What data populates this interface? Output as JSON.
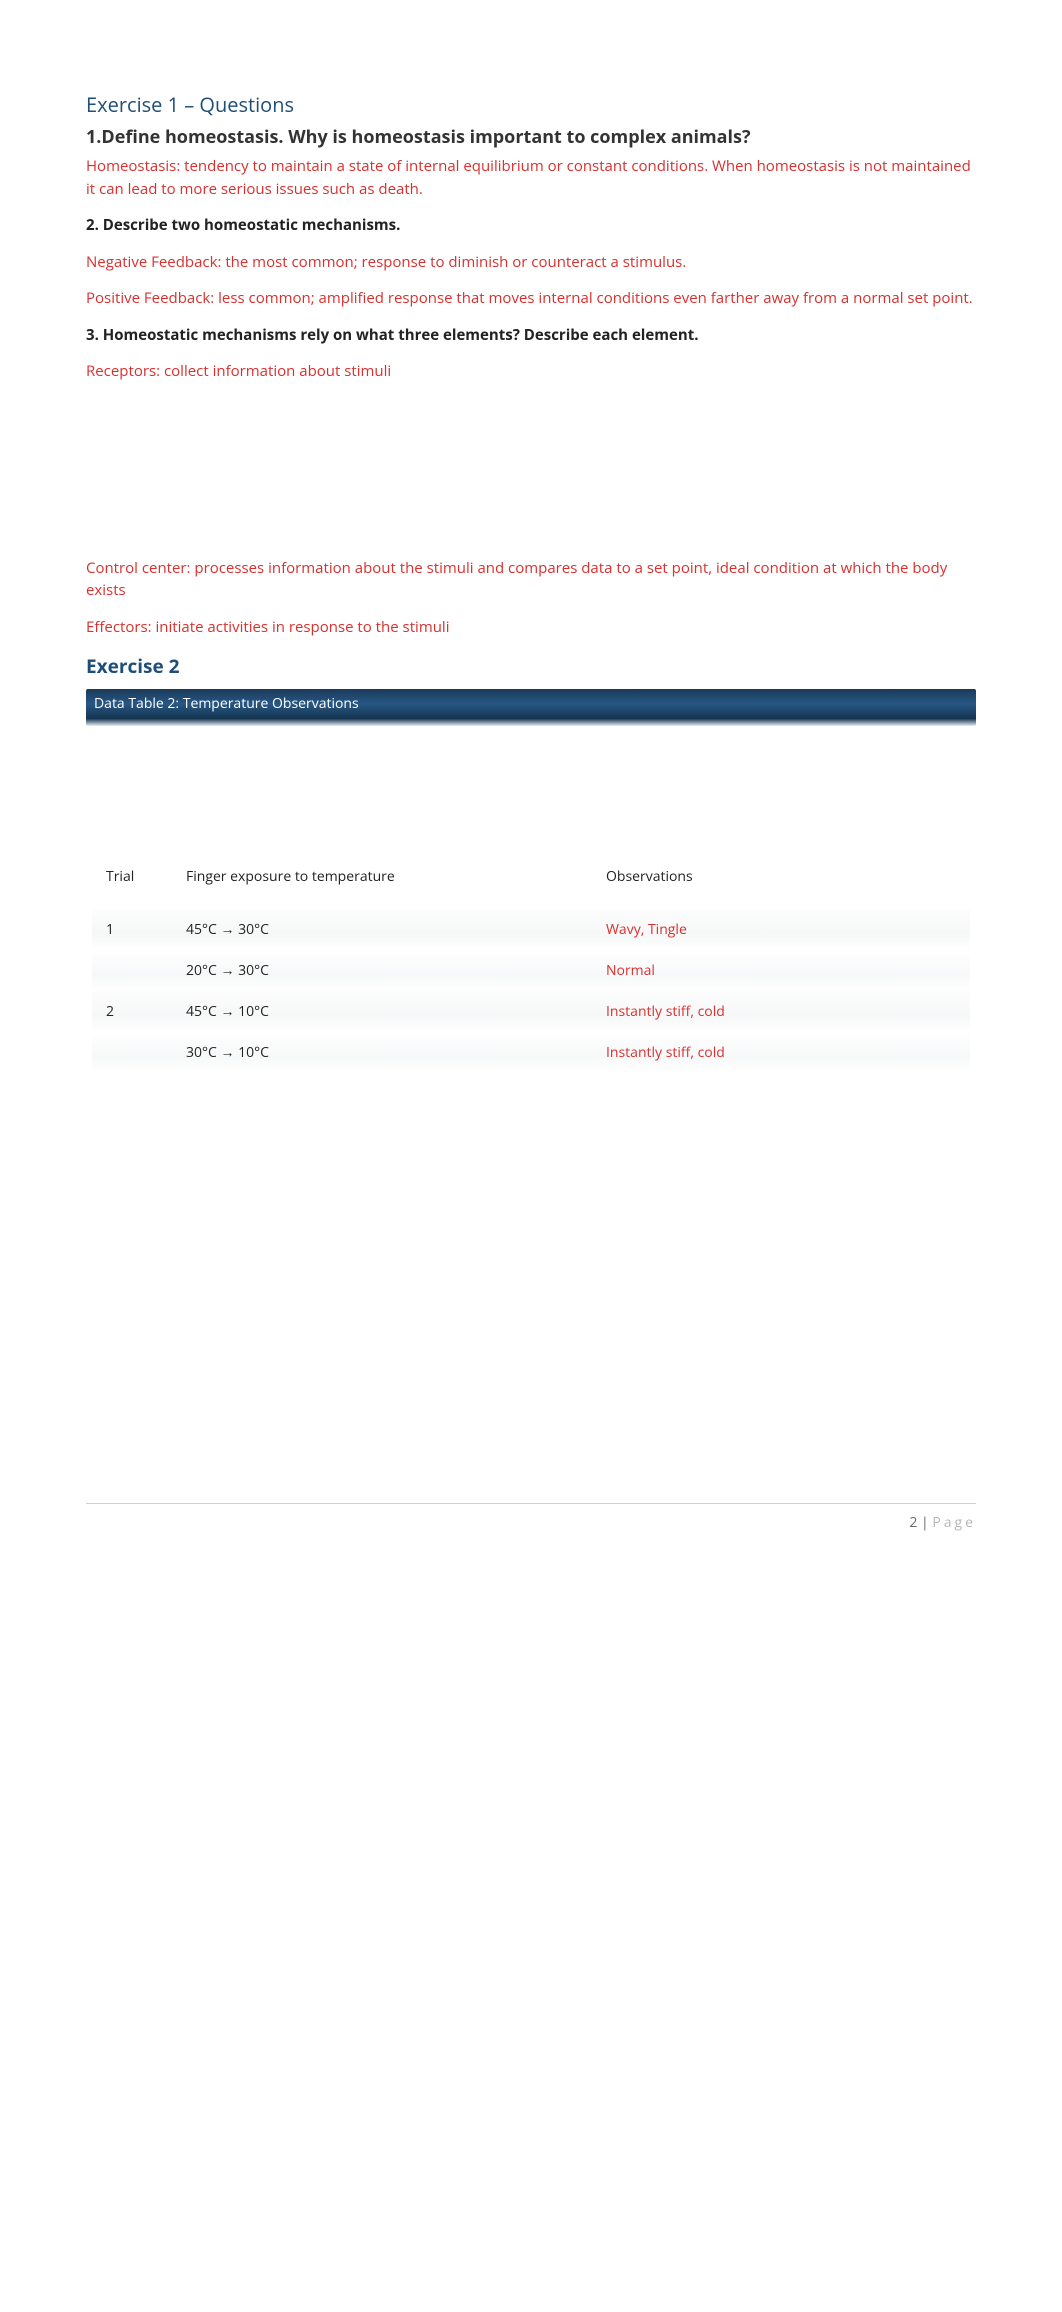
{
  "exercise1": {
    "title": "Exercise 1 – Questions",
    "q1": "1.Define homeostasis. Why is homeostasis important to complex animals?",
    "a1": "Homeostasis: tendency to maintain a state of internal equilibrium or constant conditions. When homeostasis is not maintained it can lead to more serious issues such as death.",
    "q2": "2. Describe two homeostatic mechanisms.",
    "a2a": "Negative Feedback: the most common; response to diminish or counteract a stimulus.",
    "a2b": "Positive Feedback: less common; amplified response that moves internal conditions even farther away from a normal set point.",
    "q3": "3. Homeostatic mechanisms rely on what three elements? Describe each element.",
    "a3a": "Receptors: collect information about stimuli",
    "a3b": "Control center: processes information about the stimuli and compares data to a set point, ideal condition at which the body exists",
    "a3c": "Effectors: initiate activities in response to the stimuli"
  },
  "exercise2": {
    "title": "Exercise 2",
    "table_caption": "Data Table 2: Temperature Observations",
    "headers": {
      "trial": "Trial",
      "exposure": "Finger exposure to temperature",
      "obs": "Observations"
    },
    "rows": [
      {
        "trial": "1",
        "exposure": "45°C → 30°C",
        "obs": "Wavy, Tingle"
      },
      {
        "trial": "",
        "exposure": "20°C → 30°C",
        "obs": "Normal"
      },
      {
        "trial": "2",
        "exposure": "45°C → 10°C",
        "obs": "Instantly stiff, cold"
      },
      {
        "trial": "",
        "exposure": "30°C → 10°C",
        "obs": "Instantly stiff, cold"
      }
    ]
  },
  "footer": {
    "page_num": "2",
    "sep": " | ",
    "label": "Page"
  }
}
